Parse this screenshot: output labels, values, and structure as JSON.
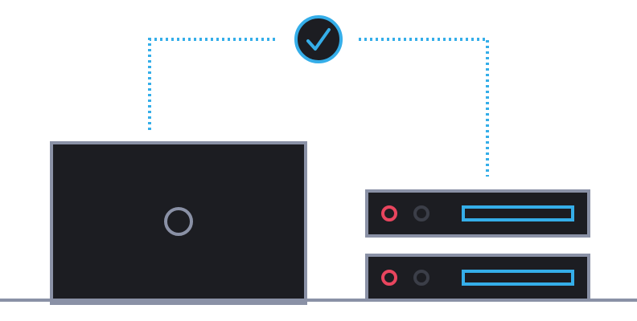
{
  "colors": {
    "background": "#ffffff",
    "device_fill": "#1c1d22",
    "device_border": "#8a91a6",
    "accent": "#35aee9",
    "status_active": "#e8455e",
    "status_inactive": "#3b3e48",
    "baseline": "#8a91a6"
  },
  "icons": {
    "badge": "checkmark-icon",
    "screen": "power-ring-icon",
    "server_slot": "drive-bay-icon"
  },
  "diagram": {
    "connection_status": "verified",
    "servers": [
      {
        "led_1": "active",
        "led_2": "inactive"
      },
      {
        "led_1": "active",
        "led_2": "inactive"
      }
    ]
  }
}
